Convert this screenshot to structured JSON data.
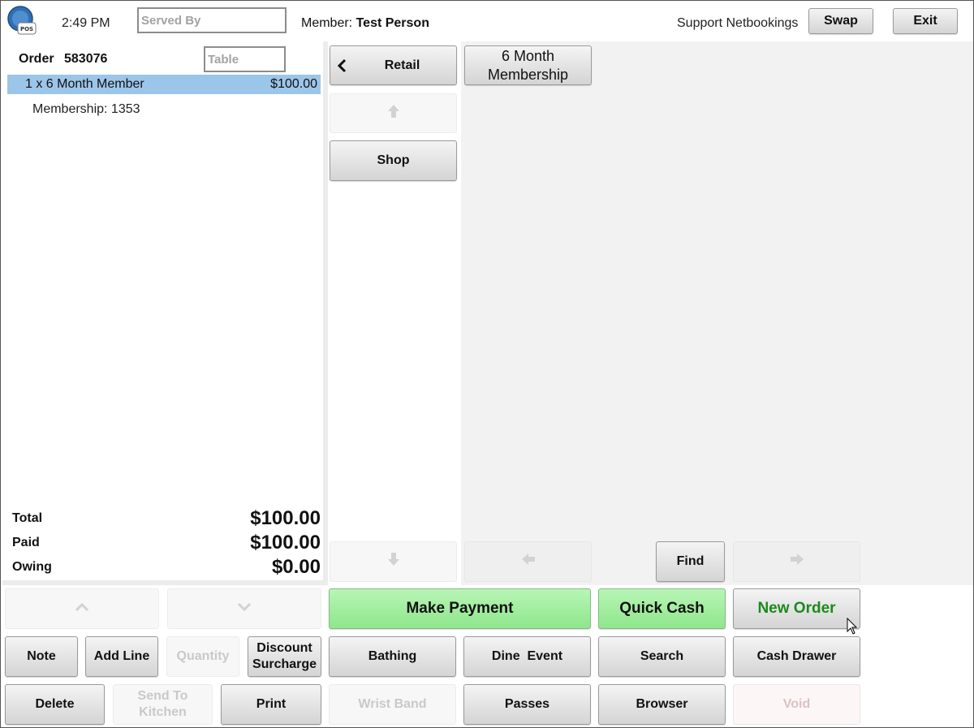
{
  "header": {
    "logo_text": "POS",
    "time": "2:49 PM",
    "served_by_placeholder": "Served By",
    "member_label": "Member:",
    "member_name": "Test Person",
    "support_label": "Support Netbookings",
    "swap_label": "Swap",
    "exit_label": "Exit"
  },
  "order": {
    "order_label": "Order",
    "order_number": "583076",
    "table_placeholder": "Table",
    "lines": [
      {
        "text": "1 x 6 Month Member",
        "price": "$100.00",
        "selected": true
      }
    ],
    "sub_line": "Membership: 1353",
    "totals": [
      {
        "label": "Total",
        "value": "$100.00"
      },
      {
        "label": "Paid",
        "value": "$100.00"
      },
      {
        "label": "Owing",
        "value": "$0.00"
      }
    ]
  },
  "categories": {
    "back_label": "Retail",
    "back_icon": "chevron-left-icon",
    "up_icon": "arrow-up-icon",
    "down_icon": "arrow-down-icon",
    "items": [
      {
        "label": "Shop"
      }
    ]
  },
  "products": {
    "items": [
      {
        "label": "6 Month Membership"
      }
    ],
    "prev_icon": "arrow-left-icon",
    "next_icon": "arrow-right-icon",
    "find_label": "Find"
  },
  "order_controls": {
    "scroll_up_icon": "chevron-up-icon",
    "scroll_down_icon": "chevron-down-icon",
    "note": "Note",
    "add_line": "Add Line",
    "quantity": "Quantity",
    "discount": "Discount Surcharge",
    "delete": "Delete",
    "send_to_kitchen": "Send To Kitchen",
    "print": "Print"
  },
  "actions": {
    "make_payment": "Make Payment",
    "quick_cash": "Quick Cash",
    "new_order": "New Order",
    "bathing": "Bathing",
    "dine_event": "Dine  Event",
    "search": "Search",
    "cash_drawer": "Cash Drawer",
    "wrist_band": "Wrist Band",
    "passes": "Passes",
    "browser": "Browser",
    "void": "Void"
  },
  "colors": {
    "selected_row": "#9cc5ea",
    "green_button": "#a6eea4",
    "new_order_text": "#1b8a1b"
  }
}
